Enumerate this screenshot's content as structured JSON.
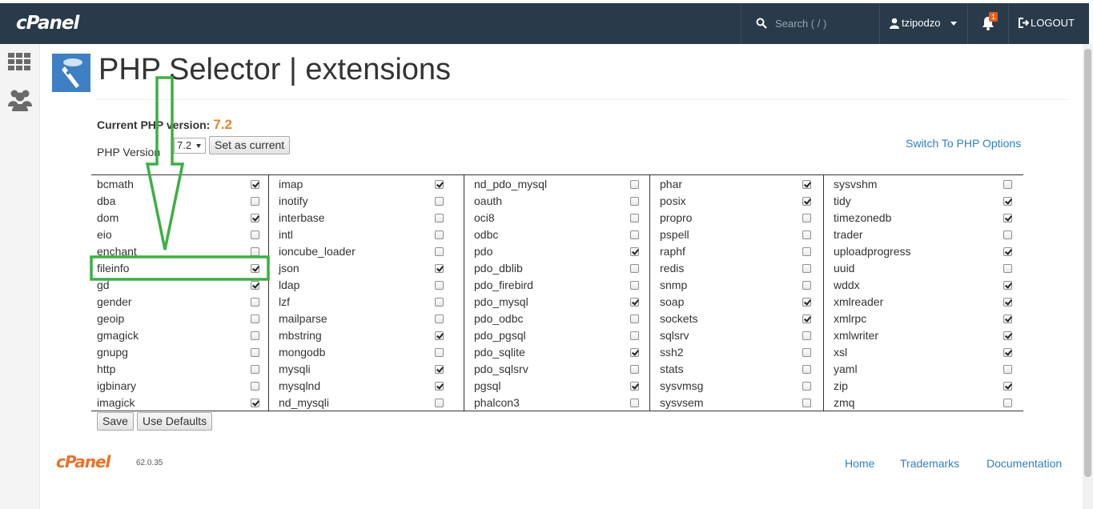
{
  "header": {
    "logo": "cPanel",
    "search_placeholder": "Search ( / )",
    "username": "tzipodzo",
    "notification_count": "1",
    "logout_label": "LOGOUT"
  },
  "sidebar": {
    "icons": [
      "grid-apps-icon",
      "users-icon"
    ]
  },
  "page": {
    "title": "PHP Selector | extensions",
    "current_version_label": "Current PHP version:",
    "current_version_value": "7.2",
    "php_version_label": "PHP Version",
    "selected_version": "7.2",
    "set_current_label": "Set as current",
    "switch_link": "Switch To PHP Options",
    "save_label": "Save",
    "defaults_label": "Use Defaults"
  },
  "extensions": [
    [
      {
        "name": "bcmath",
        "checked": true
      },
      {
        "name": "dba",
        "checked": false
      },
      {
        "name": "dom",
        "checked": true
      },
      {
        "name": "eio",
        "checked": false
      },
      {
        "name": "enchant",
        "checked": false
      },
      {
        "name": "fileinfo",
        "checked": true
      },
      {
        "name": "gd",
        "checked": true
      },
      {
        "name": "gender",
        "checked": false
      },
      {
        "name": "geoip",
        "checked": false
      },
      {
        "name": "gmagick",
        "checked": false
      },
      {
        "name": "gnupg",
        "checked": false
      },
      {
        "name": "http",
        "checked": false
      },
      {
        "name": "igbinary",
        "checked": false
      },
      {
        "name": "imagick",
        "checked": true
      }
    ],
    [
      {
        "name": "imap",
        "checked": true
      },
      {
        "name": "inotify",
        "checked": false
      },
      {
        "name": "interbase",
        "checked": false
      },
      {
        "name": "intl",
        "checked": false
      },
      {
        "name": "ioncube_loader",
        "checked": false
      },
      {
        "name": "json",
        "checked": true
      },
      {
        "name": "ldap",
        "checked": false
      },
      {
        "name": "lzf",
        "checked": false
      },
      {
        "name": "mailparse",
        "checked": false
      },
      {
        "name": "mbstring",
        "checked": true
      },
      {
        "name": "mongodb",
        "checked": false
      },
      {
        "name": "mysqli",
        "checked": true
      },
      {
        "name": "mysqlnd",
        "checked": true
      },
      {
        "name": "nd_mysqli",
        "checked": false
      }
    ],
    [
      {
        "name": "nd_pdo_mysql",
        "checked": false
      },
      {
        "name": "oauth",
        "checked": false
      },
      {
        "name": "oci8",
        "checked": false
      },
      {
        "name": "odbc",
        "checked": false
      },
      {
        "name": "pdo",
        "checked": true
      },
      {
        "name": "pdo_dblib",
        "checked": false
      },
      {
        "name": "pdo_firebird",
        "checked": false
      },
      {
        "name": "pdo_mysql",
        "checked": true
      },
      {
        "name": "pdo_odbc",
        "checked": false
      },
      {
        "name": "pdo_pgsql",
        "checked": false
      },
      {
        "name": "pdo_sqlite",
        "checked": true
      },
      {
        "name": "pdo_sqlsrv",
        "checked": false
      },
      {
        "name": "pgsql",
        "checked": true
      },
      {
        "name": "phalcon3",
        "checked": false
      }
    ],
    [
      {
        "name": "phar",
        "checked": true
      },
      {
        "name": "posix",
        "checked": true
      },
      {
        "name": "propro",
        "checked": false
      },
      {
        "name": "pspell",
        "checked": false
      },
      {
        "name": "raphf",
        "checked": false
      },
      {
        "name": "redis",
        "checked": false
      },
      {
        "name": "snmp",
        "checked": false
      },
      {
        "name": "soap",
        "checked": true
      },
      {
        "name": "sockets",
        "checked": true
      },
      {
        "name": "sqlsrv",
        "checked": false
      },
      {
        "name": "ssh2",
        "checked": false
      },
      {
        "name": "stats",
        "checked": false
      },
      {
        "name": "sysvmsg",
        "checked": false
      },
      {
        "name": "sysvsem",
        "checked": false
      }
    ],
    [
      {
        "name": "sysvshm",
        "checked": false
      },
      {
        "name": "tidy",
        "checked": true
      },
      {
        "name": "timezonedb",
        "checked": true
      },
      {
        "name": "trader",
        "checked": false
      },
      {
        "name": "uploadprogress",
        "checked": true
      },
      {
        "name": "uuid",
        "checked": false
      },
      {
        "name": "wddx",
        "checked": true
      },
      {
        "name": "xmlreader",
        "checked": true
      },
      {
        "name": "xmlrpc",
        "checked": true
      },
      {
        "name": "xmlwriter",
        "checked": true
      },
      {
        "name": "xsl",
        "checked": true
      },
      {
        "name": "yaml",
        "checked": false
      },
      {
        "name": "zip",
        "checked": true
      },
      {
        "name": "zmq",
        "checked": false
      }
    ]
  ],
  "footer": {
    "logo": "cPanel",
    "version": "62.0.35",
    "links": [
      "Home",
      "Trademarks",
      "Documentation"
    ]
  },
  "colors": {
    "topbar": "#293a4a",
    "accent_orange": "#e8822b",
    "link_blue": "#2d82c2",
    "annotation_green": "#3cb043"
  }
}
